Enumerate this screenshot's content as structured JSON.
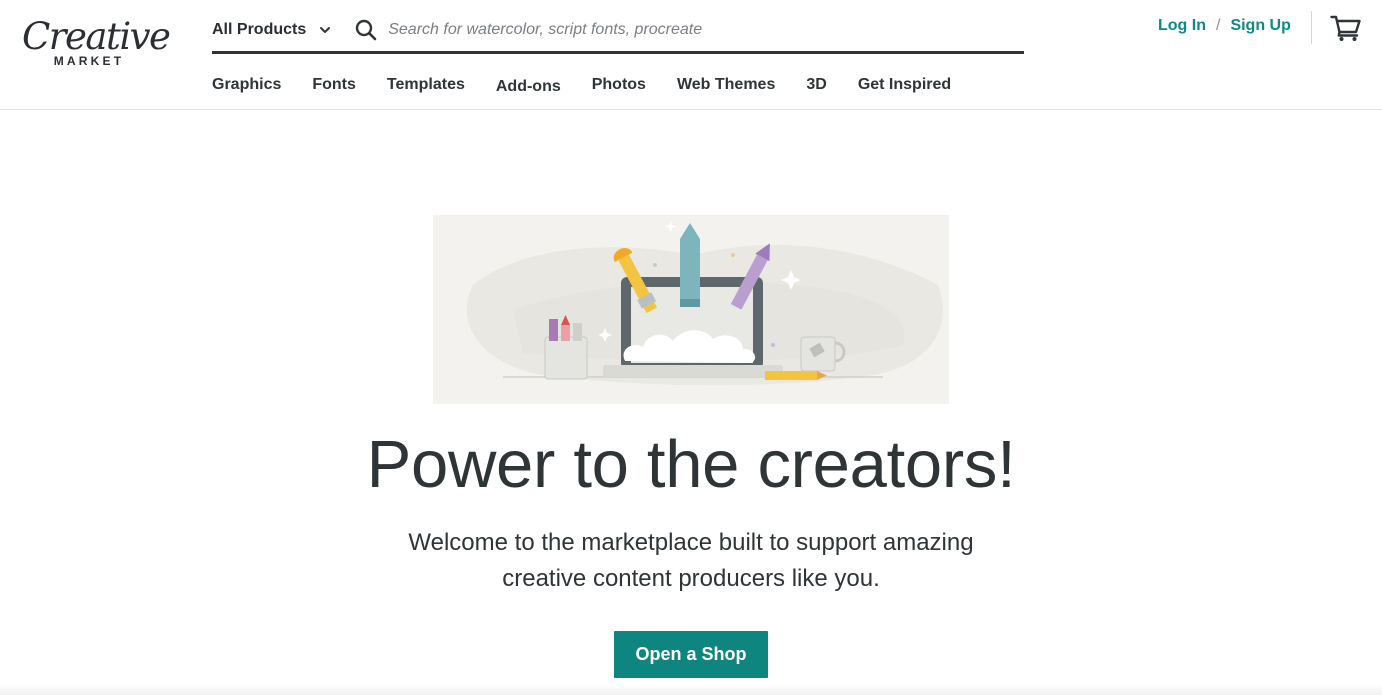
{
  "brand": {
    "logo_main": "Creative",
    "logo_sub": "MARKET"
  },
  "search": {
    "category": "All Products",
    "placeholder": "Search for watercolor, script fonts, procreate",
    "value": ""
  },
  "auth": {
    "login": "Log In",
    "separator": "/",
    "signup": "Sign Up"
  },
  "nav": {
    "items": [
      "Graphics",
      "Fonts",
      "Templates",
      "Add-ons",
      "Photos",
      "Web Themes",
      "3D",
      "Get Inspired"
    ]
  },
  "hero": {
    "title": "Power to the creators!",
    "subtitle_line1": "Welcome to the marketplace built to support amazing",
    "subtitle_line2": "creative content producers like you.",
    "cta": "Open a Shop"
  },
  "icons": {
    "search": "search-icon",
    "dropdown": "chevron-down-icon",
    "cart": "cart-icon"
  },
  "colors": {
    "accent": "#0f857f",
    "link": "#0f8a85",
    "text": "#2f3437"
  }
}
